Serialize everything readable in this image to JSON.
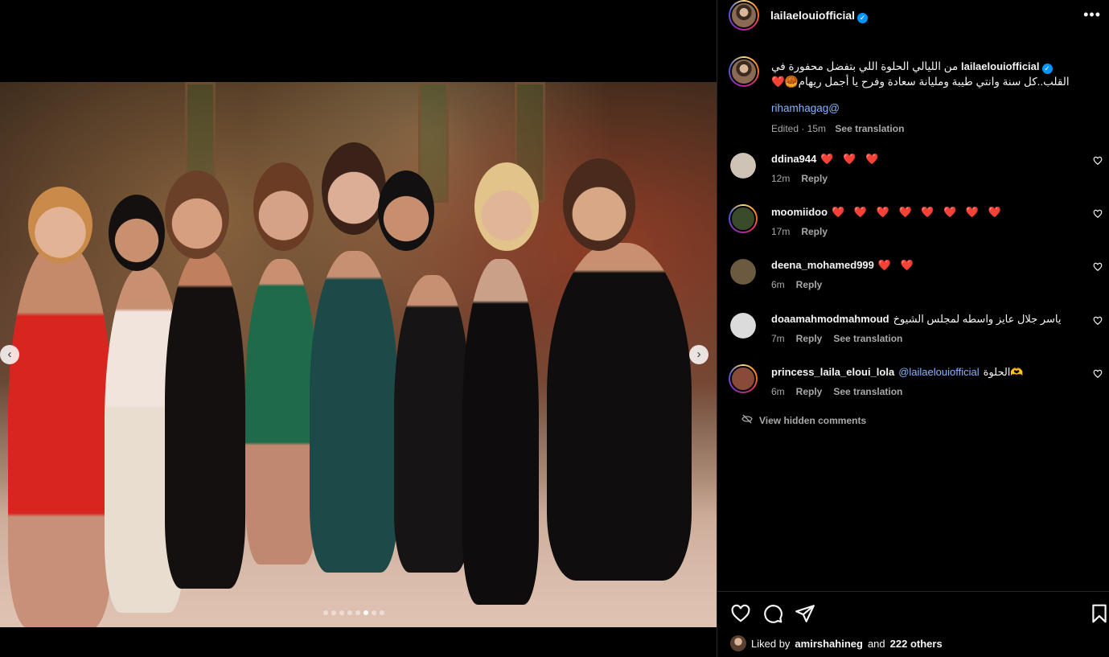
{
  "post": {
    "username": "lailaelouiofficial",
    "carousel": {
      "total": 8,
      "current": 6
    }
  },
  "caption": {
    "username": "lailaelouiofficial",
    "text": "من الليالي الحلوة اللي بتفضل محفورة في القلب..كل سنة وانتي طيبة ومليانة سعادة وفرح يا أجمل ريهام🥮❤️",
    "mention": "rihamhagag@",
    "edited": "Edited · 15m",
    "see_translation": "See translation"
  },
  "comments": [
    {
      "user": "ddina944",
      "text": "❤️ ❤️ ❤️",
      "time": "12m",
      "reply": "Reply",
      "translate": "",
      "avatar_color": "#cfc3b6"
    },
    {
      "user": "moomiidoo",
      "text": "❤️ ❤️ ❤️ ❤️ ❤️ ❤️ ❤️ ❤️",
      "time": "17m",
      "reply": "Reply",
      "translate": "",
      "avatar_color": "#3a4b2a"
    },
    {
      "user": "deena_mohamed999",
      "text": "❤️ ❤️",
      "time": "6m",
      "reply": "Reply",
      "translate": "",
      "avatar_color": "#6b5a40"
    },
    {
      "user": "doaamahmodmahmoud",
      "text": "ياسر جلال عايز واسطه لمجلس الشيوخ",
      "time": "7m",
      "reply": "Reply",
      "translate": "See translation",
      "avatar_color": "#dbdbdb"
    },
    {
      "user": "princess_laila_eloui_lola",
      "mention": "@lailaelouiofficial",
      "text": "الحلوة🫶",
      "time": "6m",
      "reply": "Reply",
      "translate": "See translation",
      "avatar_color": "#8a4a3a"
    }
  ],
  "hidden_comments": "View hidden comments",
  "likes": {
    "prefix": "Liked by",
    "user": "amirshahineg",
    "and": "and",
    "others": "222 others"
  },
  "icons": [
    "heart-icon",
    "comment-icon",
    "share-icon",
    "bookmark-icon",
    "more-icon",
    "verified-icon",
    "prev-arrow-icon",
    "next-arrow-icon",
    "eye-off-icon"
  ],
  "colors": {
    "link": "#8ab4ff",
    "heart": "#ff3040",
    "verified": "#0095f6",
    "muted": "#a8a8a8"
  }
}
